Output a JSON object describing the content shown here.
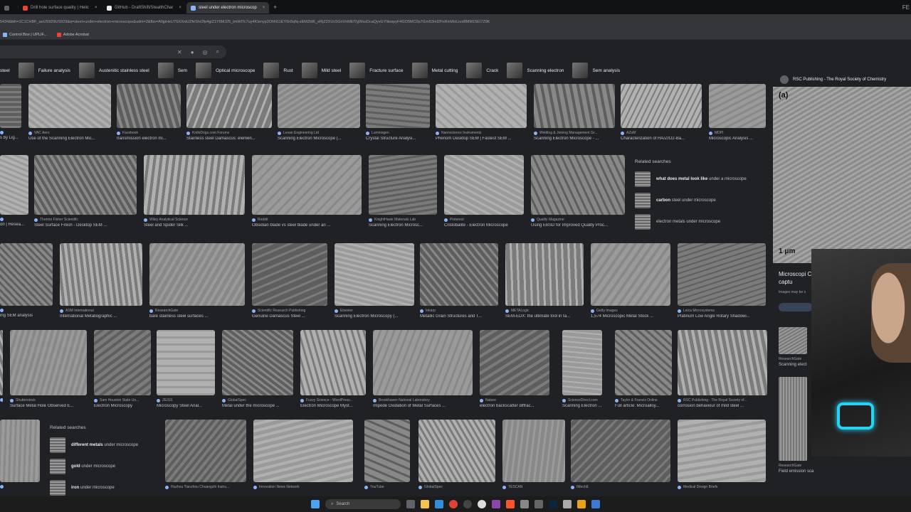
{
  "tabs": [
    {
      "label": "",
      "active": false
    },
    {
      "label": "Drill hole surface quality | Helic",
      "active": false
    },
    {
      "label": "GitHub - DraftShift/StealthChar",
      "active": false
    },
    {
      "label": "steel under electron microscop",
      "active": true
    }
  ],
  "new_tab_label": "+",
  "corner_text": "FE",
  "address_text": "5434&bih=1C1CHBF_aeUS929US929&q=steel+under+electron+microscope&udm=2&fbs=AIIjpHxU7SXXniUZfeShr2fp4giZ1Y6MJ25_tmWITc7uy4KIenyp3OhN11EY0n5qfq-zEMZldK_eRjZ2XUc5GnVnMEf7gWssDcaQyvGYlitospyF4GO5MC0p7t1m53mI2FnRmWzLtvsBMM15EI7Z9K",
  "bookmarks": [
    "Control Box | UPLIF...",
    "Adobe Acrobat"
  ],
  "chips": [
    "steel",
    "Failure analysis",
    "Austenitic stainless steel",
    "Sem",
    "Optical microscope",
    "Rust",
    "Mild steel",
    "Fracture surface",
    "Metal cutting",
    "Crack",
    "Scanning electron",
    "Sem analysis"
  ],
  "rows": [
    [
      {
        "src": "",
        "cap": "s by Lig..."
      },
      {
        "src": "VAC Aero",
        "cap": "Use of the Scanning Electron Mic..."
      },
      {
        "src": "Facebook",
        "cap": "transmission electron mi..."
      },
      {
        "src": "KnifeDogs.com Forums",
        "cap": "Stainless steel Damascus: elemen..."
      },
      {
        "src": "Lexan Engineering Ltd",
        "cap": "Scanning Electron Microscope (..."
      },
      {
        "src": "Luminogen",
        "cap": "Crystal Structure Analysi..."
      },
      {
        "src": "Nanoscience Instruments",
        "cap": "Phenom Desktop SEM | Fastest SEM ..."
      },
      {
        "src": "Welding & Joining Management Gr...",
        "cap": "Scanning Electron Microscope - ..."
      },
      {
        "src": "AZoM",
        "cap": "Characterization of HA/ZrO2-Ba..."
      },
      {
        "src": "MDPI",
        "cap": "Microscopic Analysis ..."
      }
    ],
    [
      {
        "src": "",
        "cap": "on | Resea..."
      },
      {
        "src": "Thermo Fisher Scientific",
        "cap": "Steel Surface Finish - Desktop SEM ..."
      },
      {
        "src": "Wiley Analytical Science",
        "cap": "Steel and Spider Silk ..."
      },
      {
        "src": "Reddit",
        "cap": "Obsidian blade vs steel blade under an ..."
      },
      {
        "src": "KnightHawk Materials Lab",
        "cap": "Scanning Electron Microsc..."
      },
      {
        "src": "Pinterest",
        "cap": "Cristobalite - Electron Microscope"
      },
      {
        "src": "Quality Magazine",
        "cap": "Using EBSD for Improved Quality Proc..."
      }
    ],
    [
      {
        "src": "",
        "cap": "ing SEM analysis"
      },
      {
        "src": "ASM International",
        "cap": "International Metallographic ..."
      },
      {
        "src": "ResearchGate",
        "cap": "bare stainless steel surfaces ..."
      },
      {
        "src": "Scientific Research Publishing",
        "cap": "Genuine Damascus Steel ..."
      },
      {
        "src": "Elsevier",
        "cap": "Scanning Electron Microscopy (..."
      },
      {
        "src": "Inkarp",
        "cap": "Metallic Grain Structures and T..."
      },
      {
        "src": "METALogic",
        "cap": "SEM-EDX: the ultimate tool in fa..."
      },
      {
        "src": "Getty Images",
        "cap": "1,574 Microscopic Metal Stock ..."
      },
      {
        "src": "Leica Microsystems",
        "cap": "Platinum Low Angle Rotary Shadowi..."
      }
    ],
    [
      {
        "src": "",
        "cap": ""
      },
      {
        "src": "Shutterstock",
        "cap": "Surface Metal Hole Observed E..."
      },
      {
        "src": "Sam Houston State Un...",
        "cap": "Electron Microscopy"
      },
      {
        "src": "ZEISS",
        "cap": "Microscopy Steel Anal..."
      },
      {
        "src": "GlobalSpec",
        "cap": "Metal under the microscope ..."
      },
      {
        "src": "Fuzzy Science - WordPress...",
        "cap": "Electron Microscope Myst..."
      },
      {
        "src": "Brookhaven National Laboratory",
        "cap": "Impede Oxidation of Metal Surfaces ..."
      },
      {
        "src": "Nature",
        "cap": "electron backscatter diffrac..."
      },
      {
        "src": "ScienceDirect.com",
        "cap": "Scanning Electron ..."
      },
      {
        "src": "Taylor & Francis Online",
        "cap": "Full article: Microalloy..."
      },
      {
        "src": "RSC Publishing - The Royal Society of...",
        "cap": "corrosion behaviour of mild steel ..."
      }
    ],
    [
      {
        "src": "",
        "cap": ""
      },
      {
        "src": "Huzhou Tianzhou Chuangzhi Instru...",
        "cap": ""
      },
      {
        "src": "Innovation News Network",
        "cap": ""
      },
      {
        "src": "YouTube",
        "cap": ""
      },
      {
        "src": "GlobalSpec",
        "cap": ""
      },
      {
        "src": "TESCAN",
        "cap": ""
      },
      {
        "src": "IMechE",
        "cap": ""
      },
      {
        "src": "Medical Design Briefs",
        "cap": ""
      }
    ]
  ],
  "related_top": {
    "header": "Related searches",
    "items": [
      {
        "bold": "what does metal look like",
        "rest": " under a microscope"
      },
      {
        "bold": "carbon",
        "rest": " steel under microscope"
      },
      {
        "bold": "",
        "rest": "electron metals under microscope"
      }
    ]
  },
  "related_bottom": {
    "header": "Related searches",
    "items": [
      {
        "bold": "different metals",
        "rest": " under microscope"
      },
      {
        "bold": "gold",
        "rest": " under microscope"
      },
      {
        "bold": "iron",
        "rest": " under microscope"
      }
    ]
  },
  "side_panel": {
    "source": "RSC Publishing - The Royal Society of Chemistry",
    "label": "(a)",
    "scale": "1 μm",
    "title": "Microscopi CO 2 captu",
    "note": "Images may be s",
    "thumbs": [
      {
        "src": "ResearchGate",
        "cap": "Scanning elect"
      },
      {
        "src": "ResearchGate",
        "cap": "Field emission sca"
      }
    ]
  },
  "taskbar": {
    "search": "Search"
  }
}
